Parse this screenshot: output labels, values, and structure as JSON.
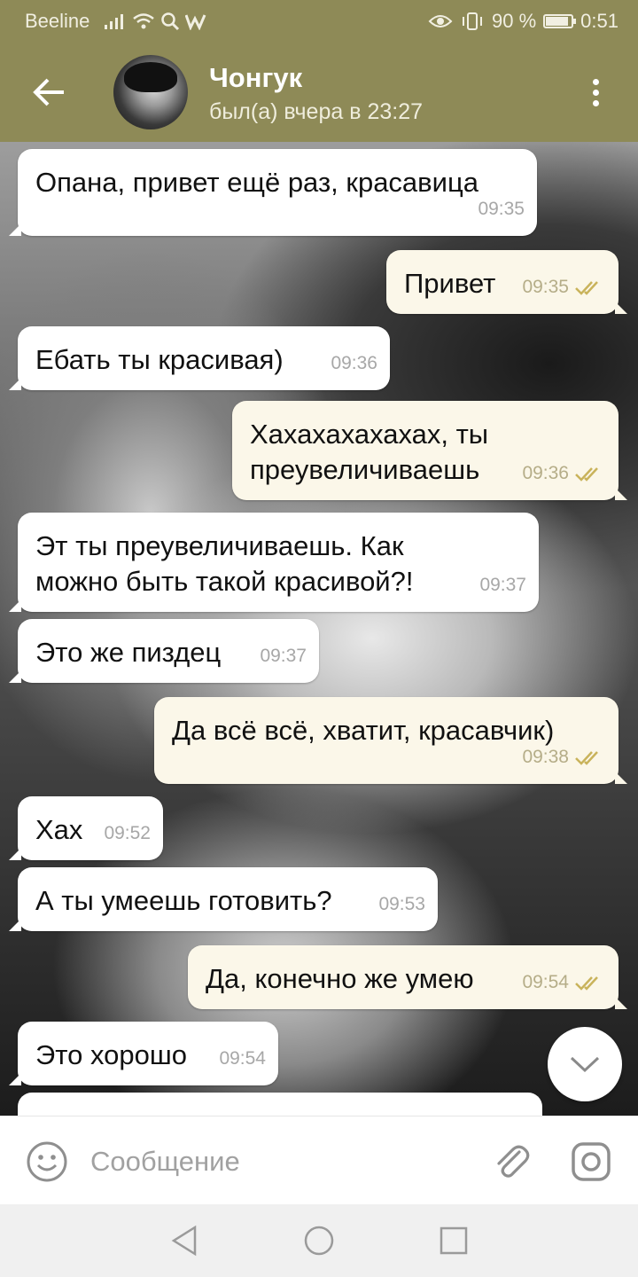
{
  "status_bar": {
    "carrier": "Beeline",
    "battery_text": "90 %",
    "battery_level": 0.9,
    "time": "0:51",
    "icons": [
      "signal-icon",
      "wifi-icon",
      "search-icon",
      "app-w-icon",
      "eye-icon",
      "vibrate-icon",
      "battery-icon"
    ]
  },
  "header": {
    "contact_name": "Чонгук",
    "contact_status": "был(а) вчера в 23:27",
    "icons": [
      "back-arrow-icon",
      "avatar",
      "more-vert-icon"
    ]
  },
  "messages": [
    {
      "direction": "in",
      "text": "Опана, привет ещё раз, красавица",
      "time": "09:35"
    },
    {
      "direction": "out",
      "text": "Привет",
      "time": "09:35",
      "read": true
    },
    {
      "direction": "in",
      "text": "Ебать ты красивая)",
      "time": "09:36"
    },
    {
      "direction": "out",
      "text": "Хахахахахахах, ты\nпреувеличиваешь",
      "time": "09:36",
      "read": true
    },
    {
      "direction": "in",
      "text": "Эт ты преувеличиваешь. Как\nможно быть такой красивой?!",
      "time": "09:37"
    },
    {
      "direction": "in",
      "text": "Это же пиздец",
      "time": "09:37"
    },
    {
      "direction": "out",
      "text": "Да всё всё, хватит, красавчик)",
      "time": "09:38",
      "read": true
    },
    {
      "direction": "in",
      "text": "Хах",
      "time": "09:52"
    },
    {
      "direction": "in",
      "text": "А ты умеешь готовить?",
      "time": "09:53"
    },
    {
      "direction": "out",
      "text": "Да, конечно же умею",
      "time": "09:54",
      "read": true
    },
    {
      "direction": "in",
      "text": "Это хорошо",
      "time": "09:54"
    }
  ],
  "input_bar": {
    "placeholder": "Сообщение",
    "value": "",
    "icons": [
      "emoji-icon",
      "attach-icon",
      "camera-icon"
    ]
  },
  "fab": {
    "icon": "chevron-down-icon"
  },
  "nav_bar": {
    "icons": [
      "nav-back-icon",
      "nav-home-icon",
      "nav-recent-icon"
    ]
  },
  "colors": {
    "header": "#8e8a57",
    "bubble_in": "#ffffff",
    "bubble_out": "#fbf7e9",
    "read_check": "#c9b35b"
  }
}
